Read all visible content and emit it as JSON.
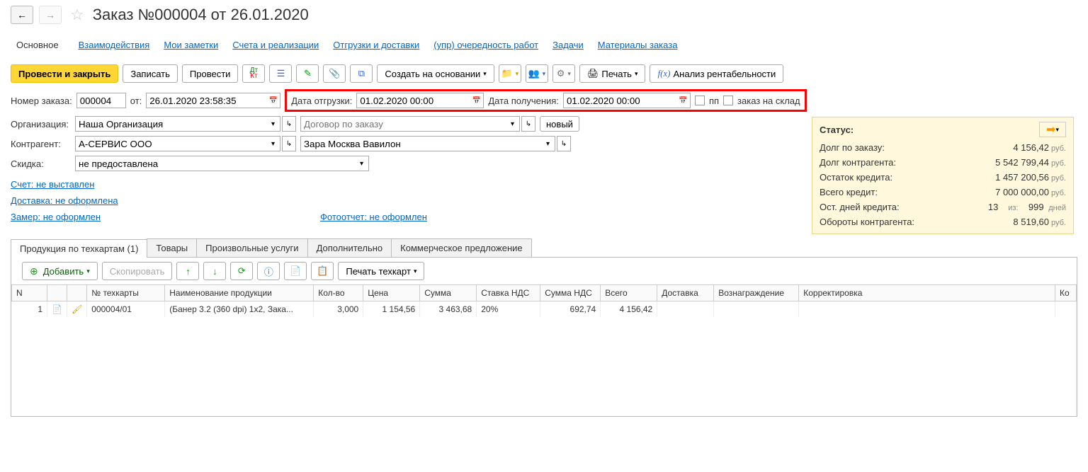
{
  "header": {
    "title": "Заказ №000004 от 26.01.2020"
  },
  "nav": {
    "main": "Основное",
    "interactions": "Взаимодействия",
    "notes": "Мои заметки",
    "invoices": "Счета и реализации",
    "shipments": "Отгрузки и доставки",
    "workorder": "(упр) очередность работ",
    "tasks": "Задачи",
    "materials": "Материалы заказа"
  },
  "toolbar": {
    "post_close": "Провести и закрыть",
    "save": "Записать",
    "post": "Провести",
    "create_based": "Создать на основании",
    "print": "Печать",
    "profitability": "Анализ рентабельности"
  },
  "form": {
    "order_no_label": "Номер заказа:",
    "order_no": "000004",
    "from_label": "от:",
    "date": "26.01.2020 23:58:35",
    "ship_date_label": "Дата отгрузки:",
    "ship_date": "01.02.2020 00:00",
    "recv_date_label": "Дата получения:",
    "recv_date": "01.02.2020 00:00",
    "pp_label": "пп",
    "to_stock_label": "заказ на склад",
    "org_label": "Организация:",
    "org": "Наша Организация",
    "contract_placeholder": "Договор по заказу",
    "new_btn": "новый",
    "counterparty_label": "Контрагент:",
    "counterparty": "А-СЕРВИС ООО",
    "store": "Зара Москва Вавилон",
    "discount_label": "Скидка:",
    "discount": "не предоставлена"
  },
  "links": {
    "invoice": "Счет: не выставлен",
    "delivery": "Доставка: не оформлена",
    "measure": "Замер: не оформлен",
    "photoreport": "Фотоотчет: не оформлен"
  },
  "status": {
    "title": "Статус:",
    "order_debt_label": "Долг по заказу:",
    "order_debt": "4 156,42",
    "cp_debt_label": "Долг контрагента:",
    "cp_debt": "5 542 799,44",
    "credit_rest_label": "Остаток кредита:",
    "credit_rest": "1 457 200,56",
    "credit_total_label": "Всего кредит:",
    "credit_total": "7 000 000,00",
    "credit_days_label": "Ост. дней кредита:",
    "credit_days": "13",
    "credit_days_of": "из:",
    "credit_days_max": "999",
    "turnover_label": "Обороты контрагента:",
    "turnover": "8 519,60",
    "rub": "руб.",
    "days": "дней"
  },
  "table_tabs": {
    "products": "Продукция по техкартам (1)",
    "goods": "Товары",
    "services": "Произвольные услуги",
    "extra": "Дополнительно",
    "offer": "Коммерческое предложение"
  },
  "table_toolbar": {
    "add": "Добавить",
    "copy": "Скопировать",
    "print_tc": "Печать техкарт"
  },
  "grid": {
    "headers": {
      "n": "N",
      "tc_no": "№ техкарты",
      "name": "Наименование продукции",
      "qty": "Кол-во",
      "price": "Цена",
      "sum": "Сумма",
      "vat_rate": "Ставка НДС",
      "vat_sum": "Сумма НДС",
      "total": "Всего",
      "delivery": "Доставка",
      "reward": "Вознаграждение",
      "korr": "Корректировка",
      "ko": "Ко"
    },
    "rows": [
      {
        "n": "1",
        "tc_no": "000004/01",
        "name": "(Банер 3.2 (360 dpi)  1x2, Зака...",
        "qty": "3,000",
        "price": "1 154,56",
        "sum": "3 463,68",
        "vat_rate": "20%",
        "vat_sum": "692,74",
        "total": "4 156,42",
        "delivery": "",
        "reward": "",
        "korr": ""
      }
    ]
  }
}
